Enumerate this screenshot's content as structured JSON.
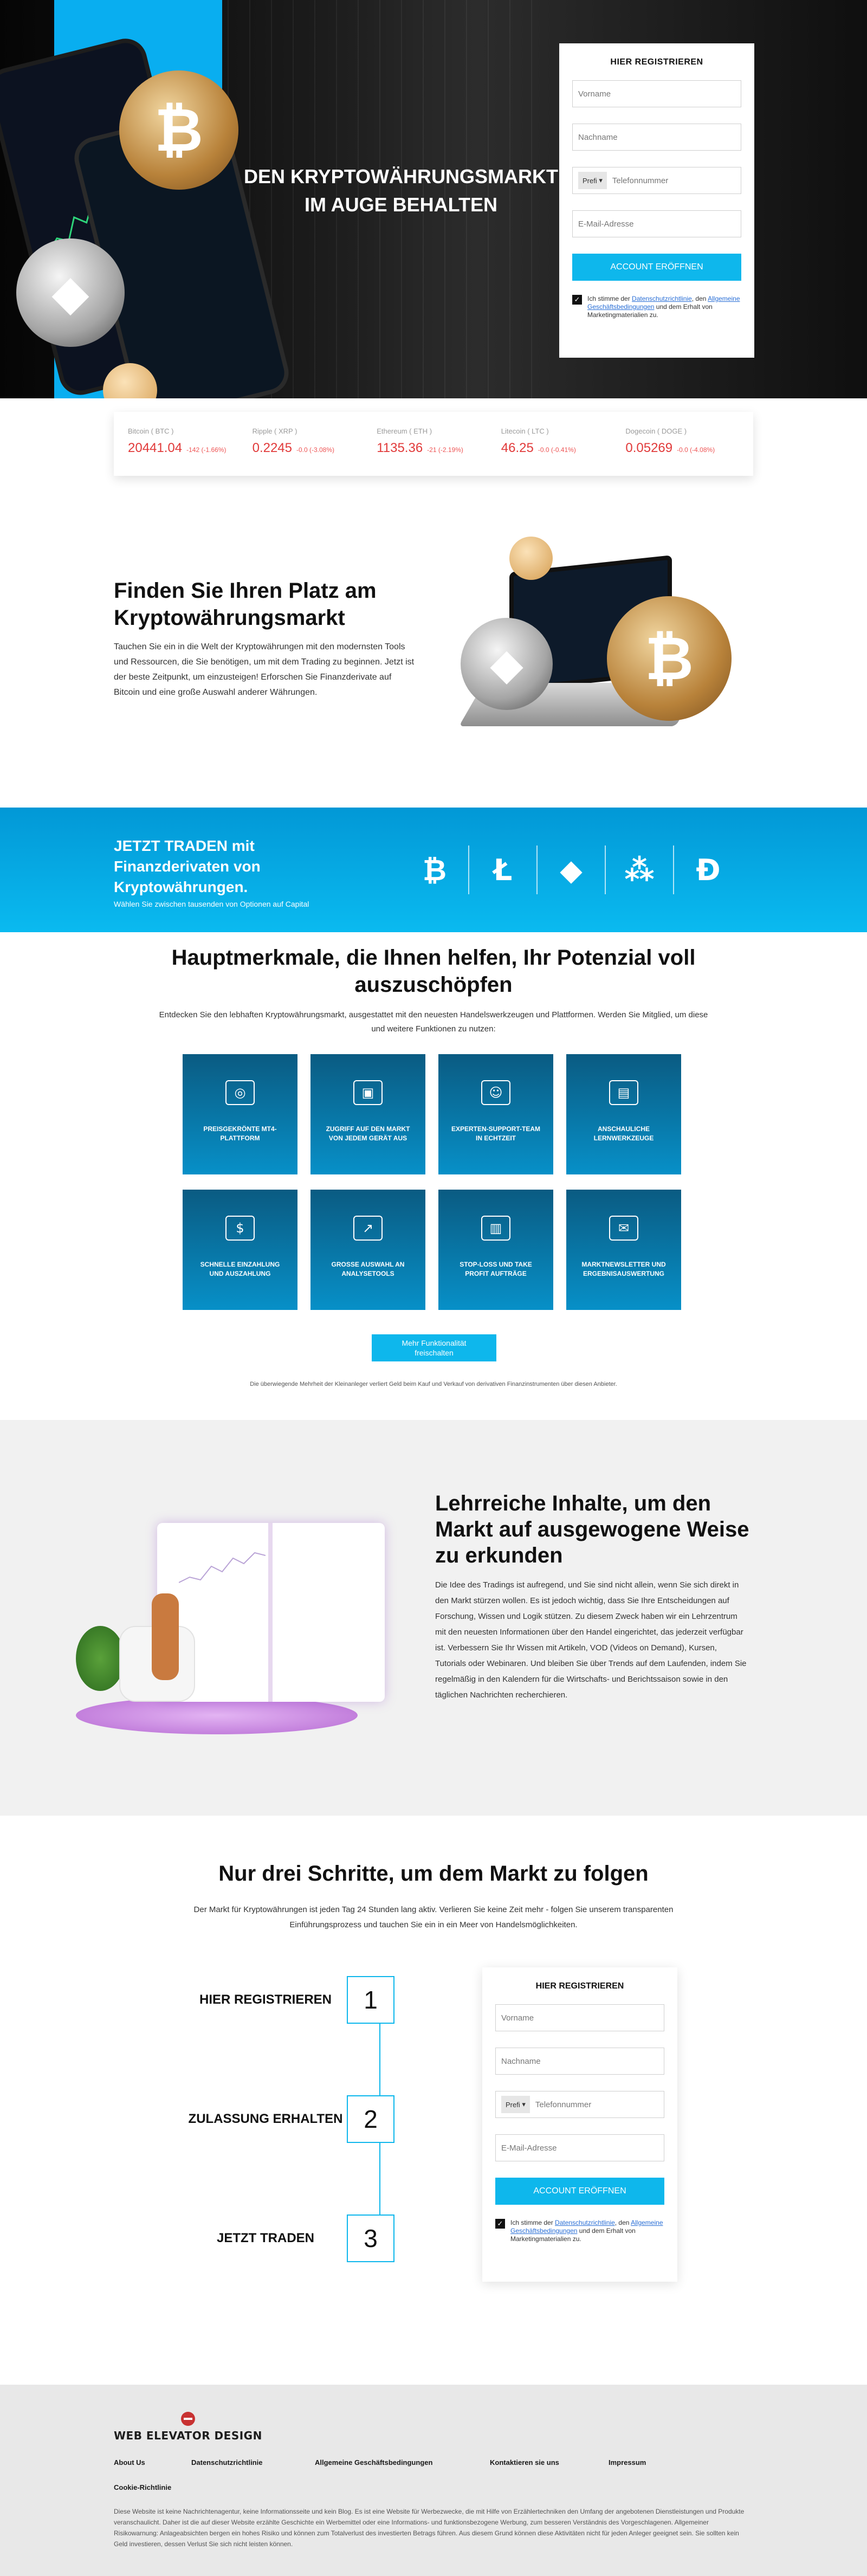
{
  "hero": {
    "title": "DEN KRYPTOWÄHRUNGSMARKT IM AUGE BEHALTEN"
  },
  "registration": {
    "title": "HIER REGISTRIEREN",
    "first_name_placeholder": "Vorname",
    "last_name_placeholder": "Nachname",
    "country_code": "Prefi",
    "phone_placeholder": "Telefonnummer",
    "email_placeholder": "E-Mail-Adresse",
    "submit_label": "ACCOUNT ERÖFFNEN",
    "consent_prefix": "Ich stimme der ",
    "privacy_link": "Datenschutzrichtlinie",
    "consent_mid": ", den ",
    "terms_link": "Allgemeine Geschäftsbedingungen",
    "consent_suffix": " und dem Erhalt von Marketingmaterialien zu."
  },
  "ticker": [
    {
      "name": "Bitcoin ( BTC )",
      "price": "20441.04",
      "change": "-142 (-1.66%)"
    },
    {
      "name": "Ripple ( XRP )",
      "price": "0.2245",
      "change": "-0.0 (-3.08%)"
    },
    {
      "name": "Ethereum ( ETH )",
      "price": "1135.36",
      "change": "-21 (-2.19%)"
    },
    {
      "name": "Litecoin ( LTC )",
      "price": "46.25",
      "change": "-0.0 (-0.41%)"
    },
    {
      "name": "Dogecoin ( DOGE )",
      "price": "0.05269",
      "change": "-0.0 (-4.08%)"
    }
  ],
  "find": {
    "title": "Finden Sie Ihren Platz am Kryptowährungsmarkt",
    "body": "Tauchen Sie ein in die Welt der Kryptowährungen mit den modernsten Tools und Ressourcen, die Sie benötigen, um mit dem Trading zu beginnen. Jetzt ist der beste Zeitpunkt, um einzusteigen! Erforschen Sie Finanzderivate auf Bitcoin und eine große Auswahl anderer Währungen."
  },
  "band": {
    "title": "JETZT TRADEN mit Finanzderivaten von Kryptowährungen.",
    "subtitle": "Wählen Sie zwischen tausenden von Optionen auf Capital",
    "icons": [
      "bitcoin-icon",
      "litecoin-icon",
      "ethereum-icon",
      "ripple-icon",
      "dogecoin-icon"
    ]
  },
  "features": {
    "title": "Hauptmerkmale, die Ihnen helfen, Ihr Potenzial voll auszuschöpfen",
    "intro": "Entdecken Sie den lebhaften Kryptowährungsmarkt, ausgestattet mit den neuesten Handelswerkzeugen und Plattformen. Werden Sie Mitglied, um diese und weitere Funktionen zu nutzen:",
    "cards": [
      {
        "label": "PREISGEKRÖNTE MT4-PLATTFORM",
        "icon": "trophy-icon"
      },
      {
        "label": "ZUGRIFF AUF DEN MARKT VON JEDEM GERÄT AUS",
        "icon": "devices-icon"
      },
      {
        "label": "EXPERTEN-SUPPORT-TEAM IN ECHTZEIT",
        "icon": "support-icon"
      },
      {
        "label": "ANSCHAULICHE LERNWERKZEUGE",
        "icon": "learning-icon"
      },
      {
        "label": "SCHNELLE EINZAHLUNG UND AUSZAHLUNG",
        "icon": "payment-icon"
      },
      {
        "label": "GROSSE AUSWAHL AN ANALYSETOOLS",
        "icon": "analytics-icon"
      },
      {
        "label": "STOP-LOSS UND TAKE PROFIT AUFTRÄGE",
        "icon": "stoploss-icon"
      },
      {
        "label": "MARKTNEWSLETTER UND ERGEBNISAUSWERTUNG",
        "icon": "newsletter-icon"
      }
    ],
    "more_button_line1": "Mehr Funktionalität",
    "more_button_line2": "freischalten",
    "disclaimer": "Die überwiegende Mehrheit der Kleinanleger verliert Geld beim Kauf und Verkauf von derivativen Finanzinstrumenten über diesen Anbieter."
  },
  "education": {
    "title": "Lehrreiche Inhalte, um den Markt auf ausgewogene Weise zu erkunden",
    "body": "Die Idee des Tradings ist aufregend, und Sie sind nicht allein, wenn Sie sich direkt in den Markt stürzen wollen. Es ist jedoch wichtig, dass Sie Ihre Entscheidungen auf Forschung, Wissen und Logik stützen. Zu diesem Zweck haben wir ein Lehrzentrum mit den neuesten Informationen über den Handel eingerichtet, das jederzeit verfügbar ist. Verbessern Sie Ihr Wissen mit Artikeln, VOD (Videos on Demand), Kursen, Tutorials oder Webinaren. Und bleiben Sie über Trends auf dem Laufenden, indem Sie regelmäßig in den Kalendern für die Wirtschafts- und Berichtssaison sowie in den täglichen Nachrichten recherchieren."
  },
  "steps": {
    "title": "Nur drei Schritte, um dem Markt zu folgen",
    "intro": "Der Markt für Kryptowährungen ist jeden Tag 24 Stunden lang aktiv. Verlieren Sie keine Zeit mehr - folgen Sie unserem transparenten Einführungsprozess und tauchen Sie ein in ein Meer von Handelsmöglichkeiten.",
    "items": [
      {
        "label": "HIER REGISTRIEREN",
        "num": "1"
      },
      {
        "label": "ZULASSUNG ERHALTEN",
        "num": "2"
      },
      {
        "label": "JETZT TRADEN",
        "num": "3"
      }
    ]
  },
  "footer": {
    "logo_text": "WEB ELEVATOR DESIGN",
    "links": [
      "About Us",
      "Datenschutzrichtlinie",
      "Allgemeine Geschäftsbedingungen",
      "Kontaktieren sie uns",
      "Impressum"
    ],
    "link_cookie": "Cookie-Richtlinie",
    "disclaimer": "Diese Website ist keine Nachrichtenagentur, keine Informationsseite und kein Blog. Es ist eine Website für Werbezwecke, die mit Hilfe von Erzählertechniken den Umfang der angebotenen Dienstleistungen und Produkte veranschaulicht. Daher ist die auf dieser Website erzählte Geschichte ein Werbemittel oder eine Informations- und funktionsbezogene Werbung, zum besseren Verständnis des Vorgeschlagenen. Allgemeiner Risikowarnung: Anlageabsichten bergen ein hohes Risiko und können zum Totalverlust des investierten Betrags führen. Aus diesem Grund können diese Aktivitäten nicht für jeden Anleger geeignet sein. Sie sollten kein Geld investieren, dessen Verlust Sie sich nicht leisten können."
  },
  "colors": {
    "accent": "#0eb7ec",
    "hero_blue": "#09aef0",
    "card_blue": "#0790c8",
    "price_red": "#e13a3a"
  }
}
